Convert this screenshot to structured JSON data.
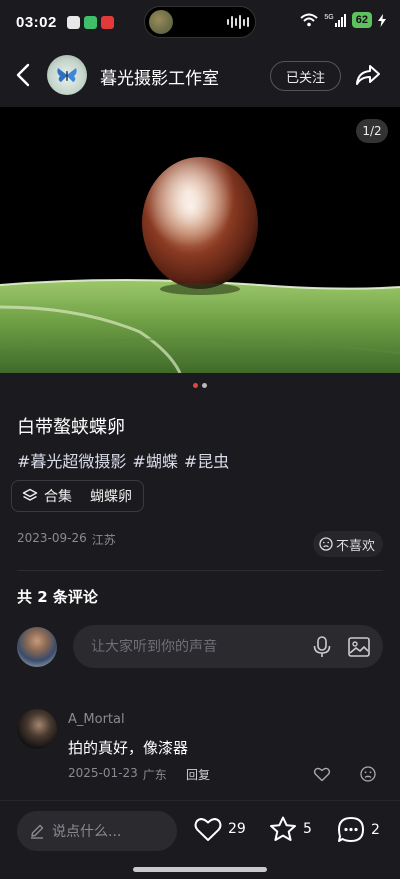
{
  "status_bar": {
    "time": "03:02",
    "apps": [
      {
        "name": "app-icon-1",
        "color": "#e8e8e8"
      },
      {
        "name": "app-icon-2",
        "color": "#3fbf6a"
      },
      {
        "name": "app-icon-3",
        "color": "#e23a3a"
      }
    ],
    "network": "5G",
    "battery": "62"
  },
  "header": {
    "title": "暮光摄影工作室",
    "follow_label": "已关注",
    "back_icon": "chevron-left-icon",
    "share_icon": "share-icon"
  },
  "photo": {
    "counter": "1/2",
    "total_images": 2,
    "active_index": 0,
    "dot_active_color": "#e0463f",
    "dot_inactive_color": "#b8b8b8"
  },
  "post": {
    "title": "白带螯蛱蝶卵",
    "tags": [
      "#暮光超微摄影",
      "#蝴蝶",
      "#昆虫"
    ],
    "collection_label": "合集",
    "collection_name": "蝴蝶卵",
    "date": "2023-09-26",
    "location": "江苏",
    "dislike_label": "不喜欢"
  },
  "comments": {
    "count_label": "共 2 条评论",
    "input_placeholder": "让大家听到你的声音",
    "items": [
      {
        "user": "A_Mortal",
        "text": "拍的真好，像漆器",
        "date": "2025-01-23",
        "location": "广东",
        "reply_label": "回复"
      }
    ]
  },
  "bottom_bar": {
    "say_placeholder": "说点什么...",
    "likes": "29",
    "favorites": "5",
    "comments": "2"
  },
  "colors": {
    "background": "#1b1b1f",
    "surface": "#2a2a2f",
    "text": "#ffffff",
    "muted": "#8a8a90"
  }
}
